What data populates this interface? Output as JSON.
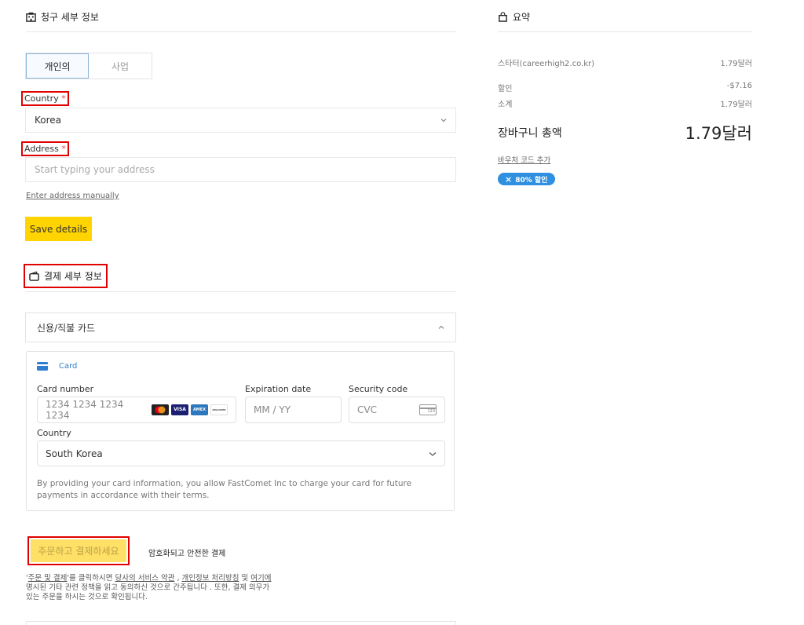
{
  "billing": {
    "title": "청구 세부 정보",
    "tabs": [
      {
        "label": "개인의"
      },
      {
        "label": "사업"
      }
    ],
    "country_label": "Country",
    "country_value": "Korea",
    "address_label": "Address",
    "address_placeholder": "Start typing your address",
    "required_mark": "*",
    "manual_link": "Enter address manually",
    "save_label": "Save details"
  },
  "payment": {
    "title": "결제 세부 정보",
    "method_title": "신용/직불 카드",
    "card_tab_label": "Card",
    "card_number_label": "Card number",
    "card_number_placeholder": "1234 1234 1234 1234",
    "expiry_label": "Expiration date",
    "expiry_placeholder": "MM / YY",
    "cvc_label": "Security code",
    "cvc_placeholder": "CVC",
    "cvc_icon_text": "123",
    "country_label": "Country",
    "country_value": "South Korea",
    "notice": "By providing your card information, you allow FastComet Inc to charge your card for future payments in accordance with their terms.",
    "brands": {
      "visa": "VISA",
      "amex": "AMEX",
      "discover": "DISCOVER"
    },
    "colors": {
      "accent": "#2f7fd0",
      "yellow": "#ffd400",
      "highlight": "#e00000"
    }
  },
  "order": {
    "button_label": "주문하고 결제하세요",
    "secure_label": "암호화되고 안전한 결제",
    "terms_prefix": "'",
    "terms_link1": "주문 및 결제",
    "terms_mid1": "'를 클릭하시면 ",
    "terms_link2": "당사의 서비스 약관",
    "terms_mid2": " , ",
    "terms_link3": "개인정보 처리방침",
    "terms_mid3": " 및 ",
    "terms_link4": "여기에",
    "terms_line2": "명시된 기타 관련 정책을 읽고 동의하신 것으로 간주됩니다 . 또한, 결제 의무가",
    "terms_line3": "있는 주문을 하시는 것으로 확인됩니다."
  },
  "summary": {
    "title": "요약",
    "item_name": "스타터(careerhigh2.co.kr)",
    "item_price": "1.79달러",
    "discount_label": "할인",
    "discount_value": "-$7.16",
    "subtotal_label": "소계",
    "subtotal_value": "1.79달러",
    "total_label": "장바구니 총액",
    "total_value": "1.79달러",
    "voucher_link": "바우처 코드 추가",
    "coupon_badge": "80% 할인",
    "coupon_remove_icon": "×"
  }
}
